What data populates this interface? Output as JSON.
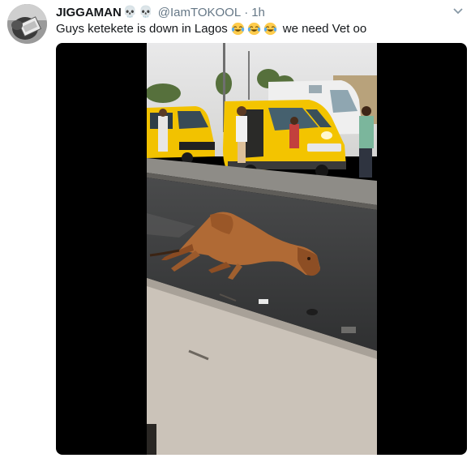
{
  "tweet": {
    "display_name": "JIGGAMAN",
    "name_icons": [
      "skull-emoji",
      "skull-emoji"
    ],
    "handle": "@IamTOKOOL",
    "separator": "·",
    "time": "1h",
    "text_before": "Guys ketekete is down in Lagos",
    "emojis": [
      "face-with-tears-of-joy",
      "face-with-tears-of-joy",
      "face-with-tears-of-joy"
    ],
    "text_after": "we need Vet oo",
    "menu_icon": "chevron-down-icon",
    "media": {
      "type": "video",
      "icon": "video-frame"
    }
  },
  "colors": {
    "name": "#14171a",
    "meta": "#657786",
    "media_bg": "#000000",
    "bus_yellow": "#f2c200",
    "horse": "#b06a35",
    "road": "#3f3f3f"
  }
}
